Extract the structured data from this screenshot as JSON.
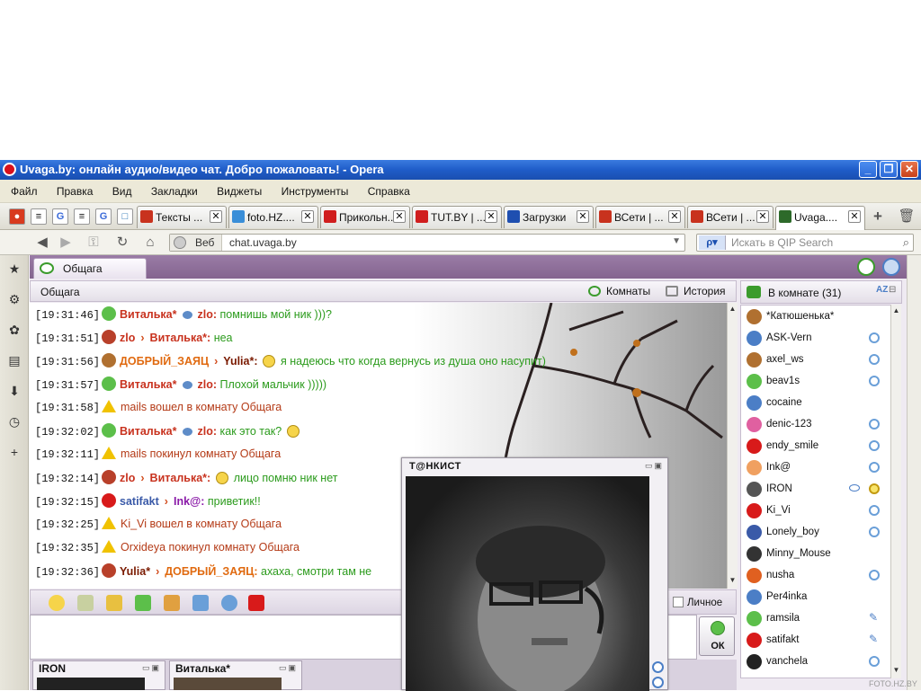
{
  "window": {
    "title": "Uvaga.by: онлайн аудио/видео чат. Добро пожаловать! - Opera",
    "minimize": "_",
    "restore": "❐",
    "close": "✕"
  },
  "menu": [
    "Файл",
    "Правка",
    "Вид",
    "Закладки",
    "Виджеты",
    "Инструменты",
    "Справка"
  ],
  "quick_icons": [
    "ladybug-icon",
    "page-icon",
    "google-icon",
    "page-icon",
    "google-icon",
    "tab-icon"
  ],
  "tabs": [
    {
      "label": "Тексты ...",
      "color": "#c8321e"
    },
    {
      "label": "foto.HZ....",
      "color": "#3a8ed8"
    },
    {
      "label": "Прикольн...",
      "color": "#d01e1e"
    },
    {
      "label": "TUT.BY | ...",
      "color": "#d01e1e"
    },
    {
      "label": "Загрузки",
      "color": "#1f4fb0"
    },
    {
      "label": "ВСети | ...",
      "color": "#c8321e"
    },
    {
      "label": "ВСети | ...",
      "color": "#c8321e"
    },
    {
      "label": "Uvaga....",
      "color": "#2d6a2a"
    }
  ],
  "address": {
    "web_label": "Веб",
    "url": "chat.uvaga.by",
    "search_placeholder": "Искать в QIP Search"
  },
  "room": {
    "tab_label": "Общага",
    "header_title": "Общага",
    "rooms_button": "Комнаты",
    "history_button": "История"
  },
  "messages": [
    {
      "time": "[19:31:46]",
      "icon": "#5cbf4a",
      "from": "Виталька*",
      "from_color": "#c8321e",
      "kind": "private",
      "to": "zlo",
      "to_color": "#c8321e",
      "text": "помнишь мой ник )))?"
    },
    {
      "time": "[19:31:51]",
      "icon": "#b8402a",
      "from": "zlo",
      "from_color": "#c8321e",
      "kind": "reply",
      "to": "Виталька*",
      "to_color": "#c8321e",
      "text": "неа"
    },
    {
      "time": "[19:31:56]",
      "icon": "#b07030",
      "from": "ДОБРЫЙ_ЗАЯЦ",
      "from_color": "#e06a10",
      "kind": "reply",
      "to": "Yulia*",
      "to_color": "#7a1a00",
      "smile": true,
      "text": "я надеюсь что когда вернусь из душа оно насупит)"
    },
    {
      "time": "[19:31:57]",
      "icon": "#5cbf4a",
      "from": "Виталька*",
      "from_color": "#c8321e",
      "kind": "private",
      "to": "zlo",
      "to_color": "#c8321e",
      "text": "Плохой мальчик )))))"
    },
    {
      "time": "[19:31:58]",
      "kind": "system",
      "text": "mails вошел в комнату Общага"
    },
    {
      "time": "[19:32:02]",
      "icon": "#5cbf4a",
      "from": "Виталька*",
      "from_color": "#c8321e",
      "kind": "private",
      "to": "zlo",
      "to_color": "#c8321e",
      "text": "как это так?",
      "smile_after": true
    },
    {
      "time": "[19:32:11]",
      "kind": "system",
      "text": "mails покинул комнату Общага"
    },
    {
      "time": "[19:32:14]",
      "icon": "#b8402a",
      "from": "zlo",
      "from_color": "#c8321e",
      "kind": "reply",
      "to": "Виталька*",
      "to_color": "#c8321e",
      "smile": true,
      "text": "лицо помню ник нет"
    },
    {
      "time": "[19:32:15]",
      "icon": "#d81a1a",
      "from": "satifakt",
      "from_color": "#3a5aa8",
      "kind": "reply",
      "to": "Ink@",
      "to_color": "#8a1aa8",
      "text": "приветик!!"
    },
    {
      "time": "[19:32:25]",
      "kind": "system",
      "text": "Ki_Vi вошел в комнату Общага"
    },
    {
      "time": "[19:32:35]",
      "kind": "system",
      "text": "Orxideya покинул комнату Общага"
    },
    {
      "time": "[19:32:36]",
      "icon": "#b8402a",
      "from": "Yulia*",
      "from_color": "#7a1a00",
      "kind": "reply",
      "to": "ДОБРЫЙ_ЗАЯЦ",
      "to_color": "#e06a10",
      "text": "ахаха, смотри там не"
    }
  ],
  "input": {
    "private_label": "Личное",
    "send_label": "ОК"
  },
  "userlist": {
    "header": "В комнате (31)",
    "users": [
      {
        "name": "*Катюшенька*",
        "color": "#b07030",
        "cam": false
      },
      {
        "name": "ASK-Vern",
        "color": "#4b7ec6",
        "cam": true
      },
      {
        "name": "axel_ws",
        "color": "#b07030",
        "cam": true
      },
      {
        "name": "beav1s",
        "color": "#5cbf4a",
        "cam": true
      },
      {
        "name": "cocaine",
        "color": "#4b7ec6",
        "cam": false
      },
      {
        "name": "denic-123",
        "color": "#e060a0",
        "cam": true
      },
      {
        "name": "endy_smile",
        "color": "#d81a1a",
        "cam": true
      },
      {
        "name": "Ink@",
        "color": "#f0a060",
        "cam": true
      },
      {
        "name": "IRON",
        "color": "#555555",
        "cam": true,
        "eye": true,
        "highlight": true
      },
      {
        "name": "Ki_Vi",
        "color": "#d81a1a",
        "cam": true
      },
      {
        "name": "Lonely_boy",
        "color": "#3a5aa8",
        "cam": true
      },
      {
        "name": "Minny_Mouse",
        "color": "#333333",
        "cam": false
      },
      {
        "name": "nusha",
        "color": "#e06020",
        "cam": true
      },
      {
        "name": "Per4inka",
        "color": "#4b7ec6",
        "cam": false
      },
      {
        "name": "ramsila",
        "color": "#5cbf4a",
        "cam": false,
        "pen": true
      },
      {
        "name": "satifakt",
        "color": "#d81a1a",
        "cam": false,
        "pen": true
      },
      {
        "name": "vanchela",
        "color": "#222222",
        "cam": true
      }
    ]
  },
  "cam_windows": [
    {
      "title": "IRON"
    },
    {
      "title": "Виталька*"
    }
  ],
  "cam_popup": {
    "title": "Т@НКИСТ"
  },
  "watermark": "FOTO.HZ.BY"
}
